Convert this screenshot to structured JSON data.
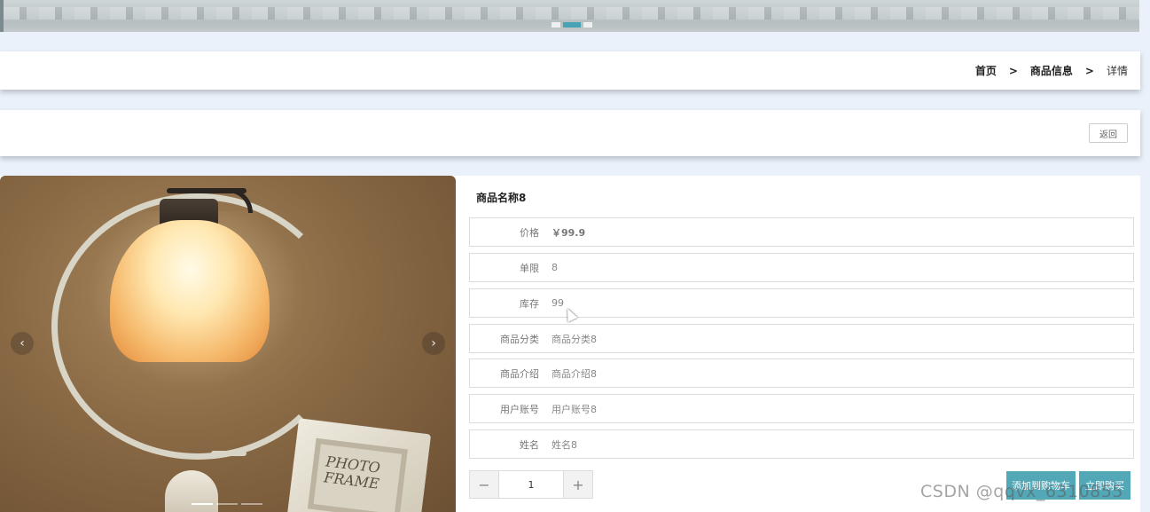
{
  "breadcrumb": {
    "home": "首页",
    "separator": ">",
    "section": "商品信息",
    "current": "详情"
  },
  "back_button": {
    "label": "返回"
  },
  "banner": {
    "slide_count": 3,
    "active_slide": 2
  },
  "carousel": {
    "prev_icon": "chevron-left-icon",
    "next_icon": "chevron-right-icon",
    "prev_glyph": "‹",
    "next_glyph": "›",
    "slide_count": 3,
    "active_slide": 1
  },
  "product": {
    "title": "商品名称8",
    "fields": [
      {
        "label": "价格",
        "value": "￥99.9"
      },
      {
        "label": "单限",
        "value": "8"
      },
      {
        "label": "库存",
        "value": "99"
      },
      {
        "label": "商品分类",
        "value": "商品分类8"
      },
      {
        "label": "商品介绍",
        "value": "商品介绍8"
      },
      {
        "label": "用户账号",
        "value": "用户账号8"
      },
      {
        "label": "姓名",
        "value": "姓名8"
      }
    ]
  },
  "quantity": {
    "minus": "−",
    "value": "1",
    "plus": "+"
  },
  "actions": {
    "add_to_cart": "添加到购物车",
    "buy_now": "立即购买"
  },
  "colors": {
    "accent": "#53a8b8",
    "page_bg": "#eaf1fa"
  },
  "watermark": "CSDN @qqvx_6310855"
}
